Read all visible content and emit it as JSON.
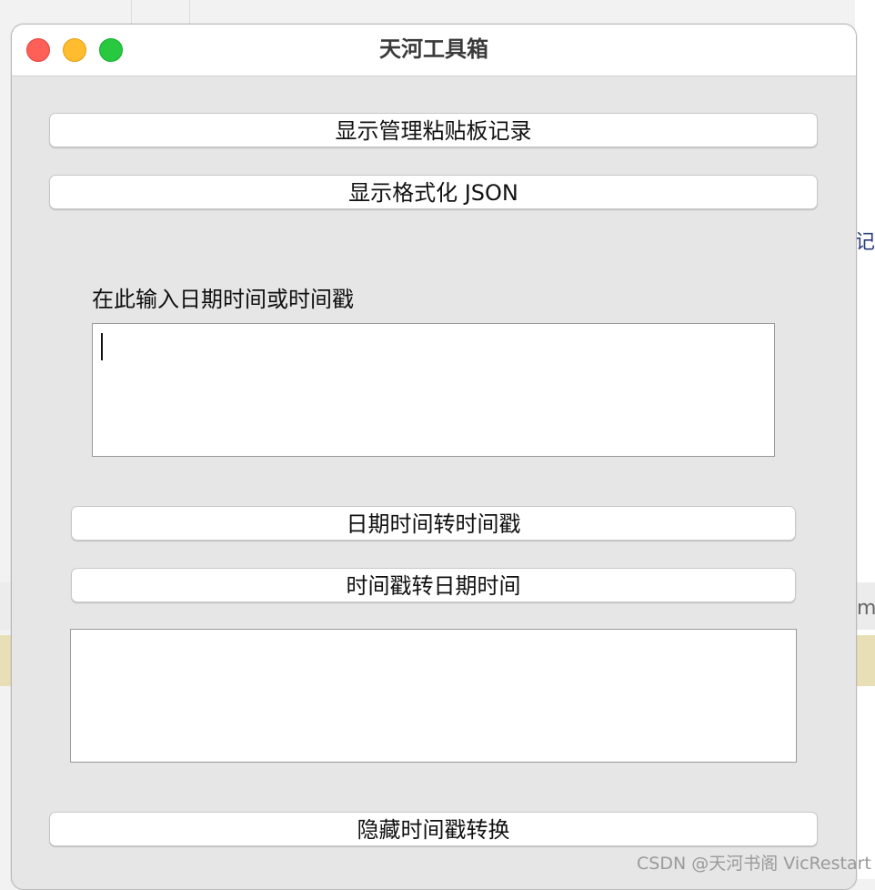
{
  "window": {
    "title": "天河工具箱"
  },
  "buttons": {
    "clipboard": "显示管理粘贴板记录",
    "json": "显示格式化 JSON",
    "date_to_ts": "日期时间转时间戳",
    "ts_to_date": "时间戳转日期时间",
    "hide": "隐藏时间戳转换"
  },
  "input": {
    "label": "在此输入日期时间或时间戳",
    "value": ""
  },
  "output": {
    "value": ""
  },
  "background": {
    "glyph_right": "记",
    "glyph_m": "m"
  },
  "watermark": "CSDN @天河书阁 VicRestart",
  "colors": {
    "close": "#fe5f57",
    "minimize": "#febc2e",
    "maximize": "#28c840",
    "window_bg": "#e6e6e6"
  }
}
